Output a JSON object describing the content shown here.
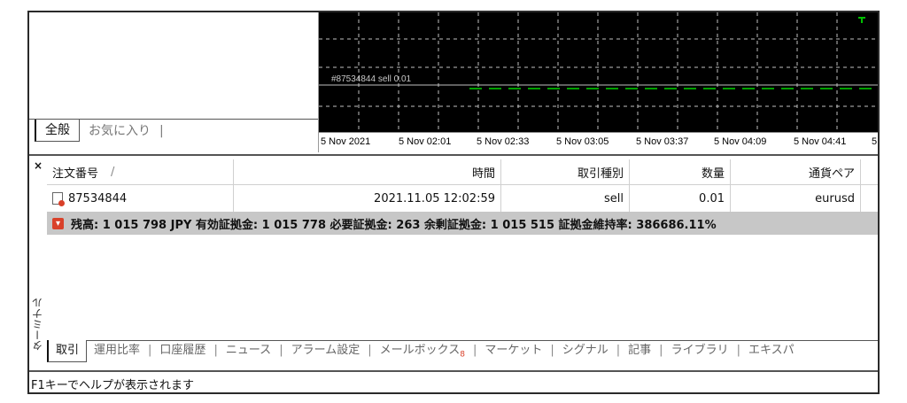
{
  "navigator": {
    "tabs": [
      "全般",
      "お気に入り"
    ]
  },
  "chart": {
    "order_line_label": "#87534844 sell 0.01",
    "time_labels": [
      "5 Nov 2021",
      "5 Nov 02:01",
      "5 Nov 02:33",
      "5 Nov 03:05",
      "5 Nov 03:37",
      "5 Nov 04:09",
      "5 Nov 04:41",
      "5"
    ],
    "colors": {
      "background": "#000000",
      "grid": "#c0c0c0",
      "order_line": "#00a000",
      "price_line": "#c0c0c0",
      "candle": "#00c000"
    }
  },
  "terminal": {
    "close_glyph": "×",
    "vertical_label": "ターミナル",
    "columns": [
      "注文番号",
      "時間",
      "取引種別",
      "数量",
      "通貨ペア"
    ],
    "sort_indicator": "/",
    "orders": [
      {
        "ticket": "87534844",
        "time": "2021.11.05 12:02:59",
        "type": "sell",
        "volume": "0.01",
        "symbol": "eurusd"
      }
    ],
    "balance_line": "残高: 1 015 798 JPY  有効証拠金: 1 015 778  必要証拠金: 263  余剰証拠金: 1 015 515  証拠金維持率: 386686.11%",
    "tabs": [
      "取引",
      "運用比率",
      "口座履歴",
      "ニュース",
      "アラーム設定",
      "メールボックス",
      "マーケット",
      "シグナル",
      "記事",
      "ライブラリ",
      "エキスパ"
    ],
    "mailbox_badge": "8"
  },
  "status_bar": {
    "text": "F1キーでヘルプが表示されます"
  }
}
